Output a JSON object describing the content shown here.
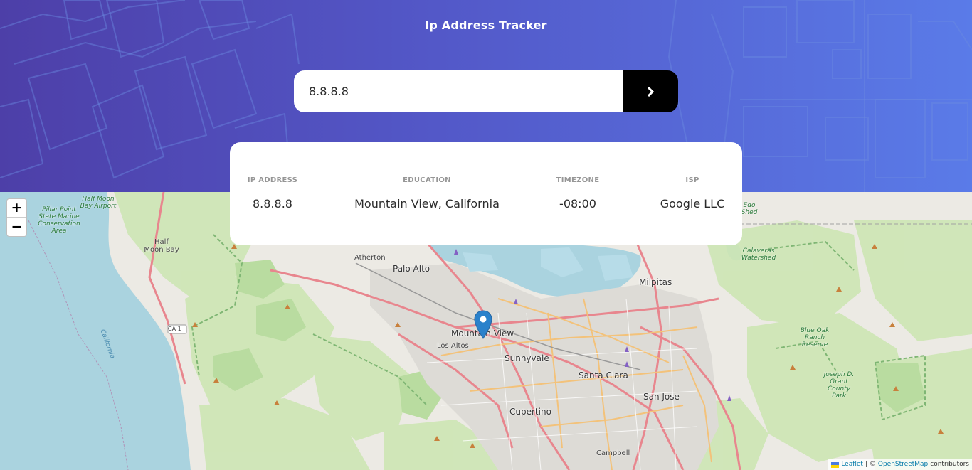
{
  "app": {
    "title": "Ip Address Tracker"
  },
  "search": {
    "value": "8.8.8.8",
    "submit_icon": "chevron-right-icon"
  },
  "info": {
    "ip_label": "IP ADDRESS",
    "ip_value": "8.8.8.8",
    "location_label": "EDUCATION",
    "location_value": "Mountain View, California",
    "timezone_label": "TIMEZONE",
    "timezone_value": "-08:00",
    "isp_label": "ISP",
    "isp_value": "Google LLC"
  },
  "map": {
    "zoom_in": "+",
    "zoom_out": "−",
    "marker_icon": "map-pin-icon",
    "cities": [
      "Palo Alto",
      "Milpitas",
      "Mountain View",
      "Sunnyvale",
      "Santa Clara",
      "San Jose",
      "Cupertino",
      "Campbell"
    ],
    "towns": [
      "Half Moon Bay",
      "Atherton",
      "Los Altos"
    ],
    "parks": [
      "Half Moon Bay Airport",
      "Pillar Point State Marine Conservation Area",
      "Calaveras Watershed",
      "Blue Oak Ranch Reserve",
      "Joseph D. Grant County Park",
      "Edo Shed"
    ],
    "road_shields": [
      "CA 1"
    ],
    "coast_label": "California",
    "attribution": {
      "leaflet": "Leaflet",
      "separator": "| ©",
      "osm": "OpenStreetMap",
      "contributors": "contributors"
    }
  },
  "colors": {
    "header_start": "#4d3fa8",
    "header_end": "#5a7be8",
    "button": "#000000",
    "marker": "#2a81cb",
    "water": "#aad3df",
    "park": "#b9dca0"
  }
}
